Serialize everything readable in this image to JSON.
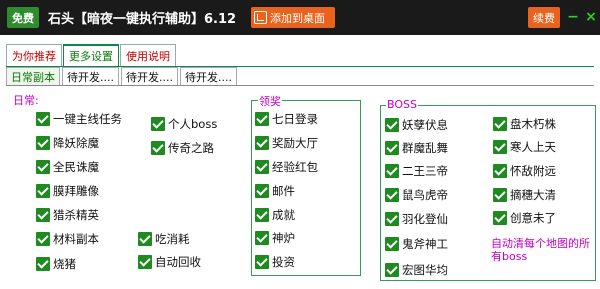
{
  "titlebar": {
    "free_badge": "免费",
    "app_title": "石头【暗夜一键执行辅助】6.12",
    "add_desktop": "添加到桌面",
    "renew": "续费",
    "minimize": "−",
    "close": "×",
    "icons": {
      "add_desktop": "home-icon"
    }
  },
  "tabs_top": [
    {
      "label": "为你推荐"
    },
    {
      "label": "更多设置"
    },
    {
      "label": "使用说明"
    }
  ],
  "tabs_sub": [
    {
      "label": "日常副本"
    },
    {
      "label": "待开发...."
    },
    {
      "label": "待开发...."
    },
    {
      "label": "待开发...."
    }
  ],
  "daily": {
    "label": "日常:",
    "items": [
      {
        "label": "一键主线任务",
        "checked": true
      },
      {
        "label": "个人boss",
        "checked": true
      },
      {
        "label": "降妖除魔",
        "checked": true
      },
      {
        "label": "传奇之路",
        "checked": true
      },
      {
        "label": "全民诛魔",
        "checked": true
      },
      {
        "label": "膜拜雕像",
        "checked": true
      },
      {
        "label": "猎杀精英",
        "checked": true
      },
      {
        "label": "材料副本",
        "checked": true
      },
      {
        "label": "吃消耗",
        "checked": true
      },
      {
        "label": "烧猪",
        "checked": true
      },
      {
        "label": "自动回收",
        "checked": true
      }
    ]
  },
  "reward": {
    "label": "领奖",
    "items": [
      {
        "label": "七日登录",
        "checked": true
      },
      {
        "label": "奖励大厅",
        "checked": true
      },
      {
        "label": "经验红包",
        "checked": true
      },
      {
        "label": "邮件",
        "checked": true
      },
      {
        "label": "成就",
        "checked": true
      },
      {
        "label": "神炉",
        "checked": true
      },
      {
        "label": "投资",
        "checked": true
      }
    ]
  },
  "boss": {
    "label": "BOSS",
    "items": [
      {
        "label": "妖孽伏息",
        "checked": true
      },
      {
        "label": "盘木朽株",
        "checked": true
      },
      {
        "label": "群魔乱舞",
        "checked": true
      },
      {
        "label": "寒人上天",
        "checked": true
      },
      {
        "label": "二王三帝",
        "checked": true
      },
      {
        "label": "怀敌附远",
        "checked": true
      },
      {
        "label": "鼠鸟虎帝",
        "checked": true
      },
      {
        "label": "摘穗大清",
        "checked": true
      },
      {
        "label": "羽化登仙",
        "checked": true
      },
      {
        "label": "创意未了",
        "checked": true
      },
      {
        "label": "鬼斧神工",
        "checked": true
      },
      {
        "label": "宏图华均",
        "checked": true
      }
    ],
    "note": "自动清每个地图的所有boss"
  },
  "colors": {
    "titlebar": "#1a1a1a",
    "free": "#2e8b2e",
    "accent": "#e8641e",
    "check": "#1f8a1f",
    "group_border": "#3a9a5a",
    "label": "#c000c0"
  }
}
